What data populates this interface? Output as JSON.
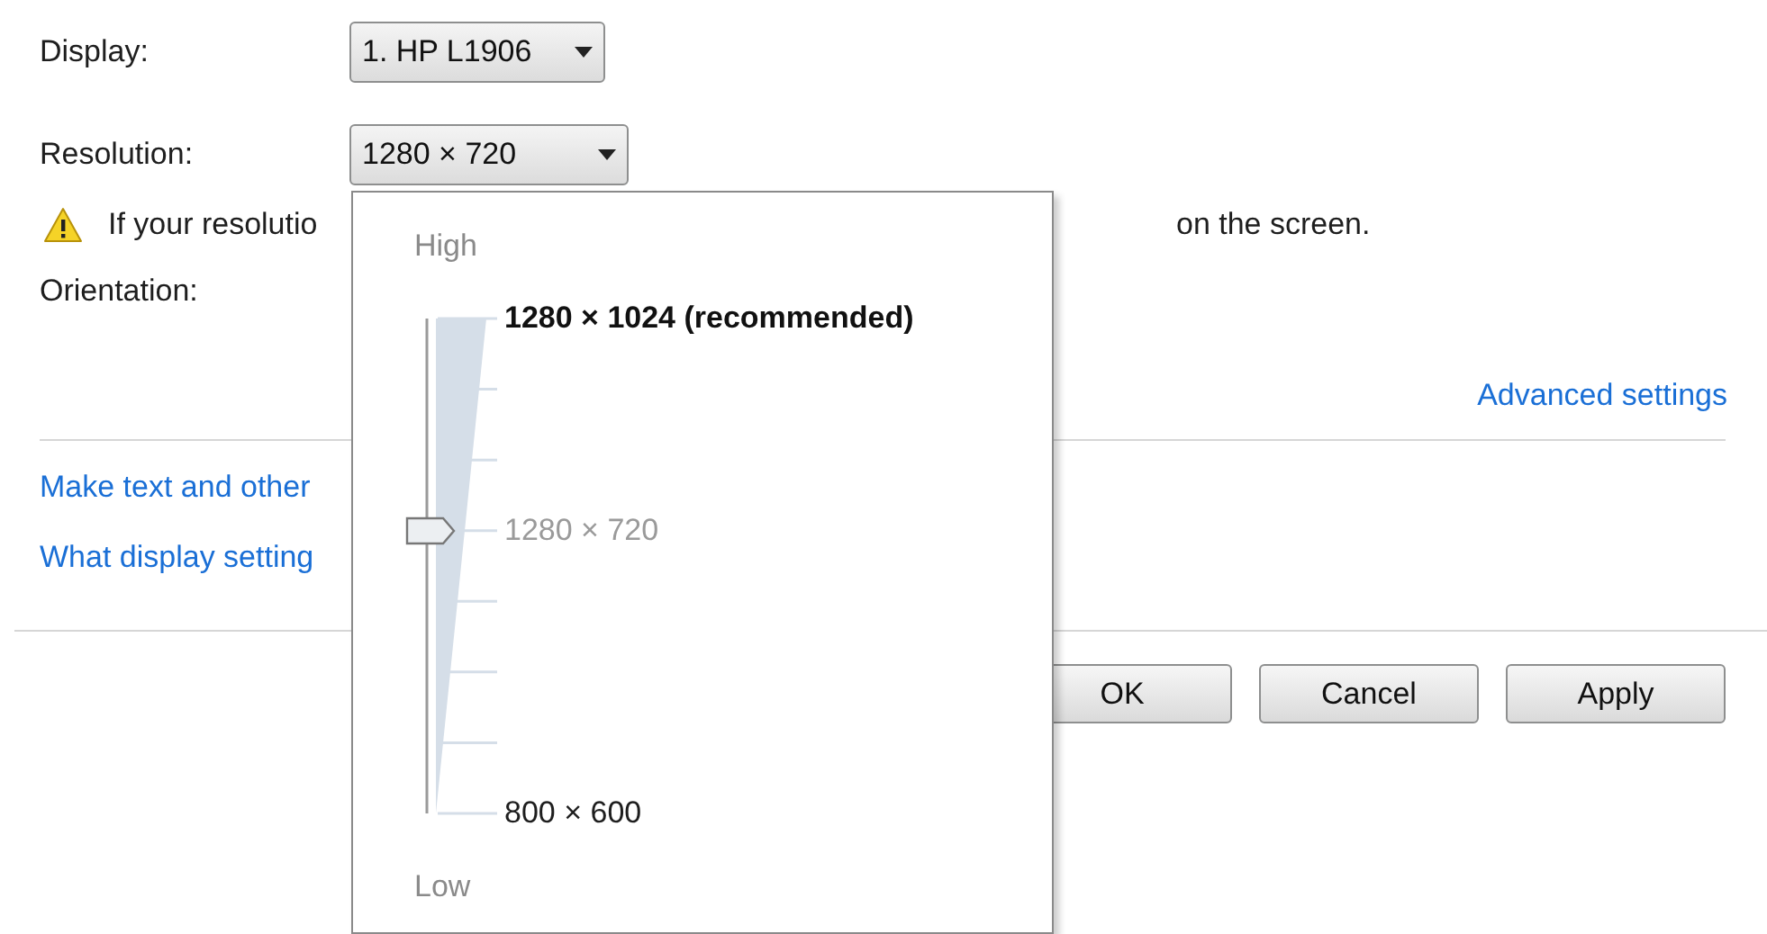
{
  "display": {
    "label": "Display:",
    "value": "1. HP L1906"
  },
  "resolution": {
    "label": "Resolution:",
    "value": "1280 × 720"
  },
  "warning": {
    "text_start": "If your resolutio",
    "text_end": "on the screen."
  },
  "orientation": {
    "label": "Orientation:"
  },
  "advanced_link": "Advanced settings",
  "links": [
    "Make text and other",
    "What display setting"
  ],
  "buttons": [
    "OK",
    "Cancel",
    "Apply"
  ],
  "resolution_popup": {
    "high_label": "High",
    "low_label": "Low",
    "level": 0.57,
    "stops": [
      {
        "kind": "recommended",
        "label": "1280 × 1024 (recommended)"
      },
      {
        "kind": "tick"
      },
      {
        "kind": "tick"
      },
      {
        "kind": "current",
        "label": "1280 × 720"
      },
      {
        "kind": "tick"
      },
      {
        "kind": "tick"
      },
      {
        "kind": "tick"
      },
      {
        "kind": "endpoint",
        "label": "800 × 600"
      }
    ]
  }
}
